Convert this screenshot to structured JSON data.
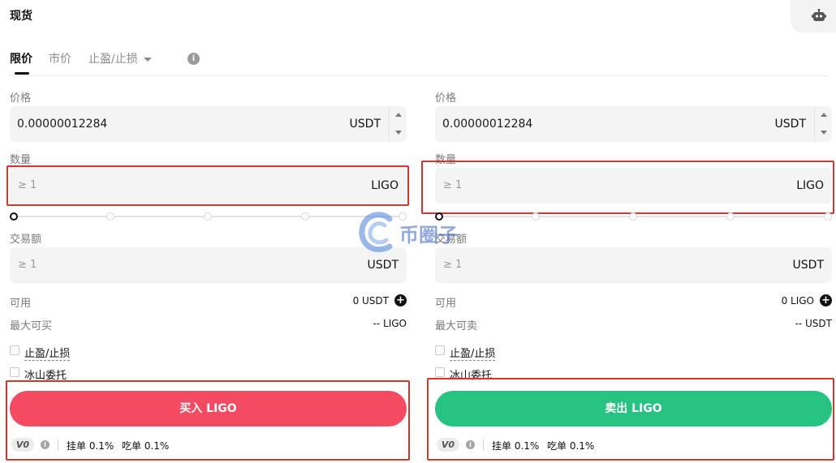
{
  "header": {
    "title": "现货"
  },
  "tabs": [
    {
      "label": "限价"
    },
    {
      "label": "市价"
    },
    {
      "label": "止盈/止损"
    }
  ],
  "buy": {
    "price_label": "价格",
    "price_value": "0.00000012284",
    "price_unit": "USDT",
    "qty_label": "数量",
    "qty_placeholder": "≥ 1",
    "qty_unit": "LIGO",
    "amount_label": "交易额",
    "amount_placeholder": "≥ 1",
    "amount_unit": "USDT",
    "available_label": "可用",
    "available_value": "0 USDT",
    "max_label": "最大可买",
    "max_value": "-- LIGO",
    "tp_sl_label": "止盈/止损",
    "iceberg_label": "冰山委托",
    "action_label": "买入 LIGO",
    "vip_label": "V0",
    "maker_fee": "挂单 0.1%",
    "taker_fee": "吃单 0.1%"
  },
  "sell": {
    "price_label": "价格",
    "price_value": "0.00000012284",
    "price_unit": "USDT",
    "qty_label": "数量",
    "qty_placeholder": "≥ 1",
    "qty_unit": "LIGO",
    "amount_label": "交易额",
    "amount_placeholder": "≥ 1",
    "amount_unit": "USDT",
    "available_label": "可用",
    "available_value": "0 LIGO",
    "max_label": "最大可卖",
    "max_value": "-- USDT",
    "tp_sl_label": "止盈/止损",
    "iceberg_label": "冰山委托",
    "action_label": "卖出 LIGO",
    "vip_label": "V0",
    "maker_fee": "挂单 0.1%",
    "taker_fee": "吃单 0.1%"
  },
  "watermark": {
    "text": "币圈子"
  },
  "colors": {
    "buy": "#f54b62",
    "sell": "#26c281",
    "highlight": "#d9342b"
  },
  "icons": {
    "robot": "robot-icon",
    "info": "info-icon",
    "plus": "plus-circle-icon",
    "caret": "caret-down-icon"
  }
}
